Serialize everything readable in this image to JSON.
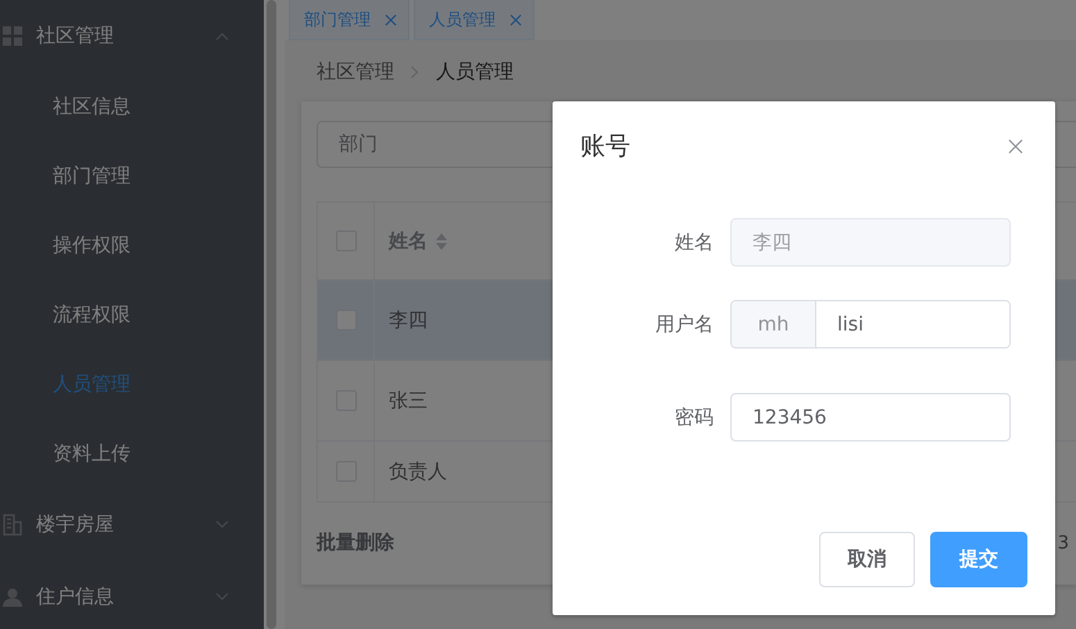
{
  "sidebar": {
    "groups": [
      {
        "label": "社区管理",
        "kind": "grid",
        "expanded": true,
        "children": [
          {
            "label": "社区信息",
            "selected": false
          },
          {
            "label": "部门管理",
            "selected": false
          },
          {
            "label": "操作权限",
            "selected": false
          },
          {
            "label": "流程权限",
            "selected": false
          },
          {
            "label": "人员管理",
            "selected": true
          },
          {
            "label": "资料上传",
            "selected": false
          }
        ]
      },
      {
        "label": "楼宇房屋",
        "kind": "building",
        "expanded": false
      },
      {
        "label": "住户信息",
        "kind": "person",
        "expanded": false
      }
    ]
  },
  "tabs": [
    {
      "label": "部门管理"
    },
    {
      "label": "人员管理"
    }
  ],
  "breadcrumb": [
    "社区管理",
    "人员管理"
  ],
  "filter": {
    "placeholder": "部门"
  },
  "table": {
    "header_checked": false,
    "columns": [
      {
        "label": "姓名",
        "sortable": true
      }
    ],
    "rows": [
      {
        "name": "李四",
        "highlighted": true,
        "checked": false
      },
      {
        "name": "张三",
        "highlighted": false,
        "checked": false
      },
      {
        "name": "负责人",
        "highlighted": false,
        "checked": false
      }
    ]
  },
  "batch_delete": "批量删除",
  "pager_text": "3",
  "dialog": {
    "title": "账号",
    "fields": [
      {
        "label": "姓名",
        "kind": "disabled",
        "value": "李四"
      },
      {
        "label": "用户名",
        "kind": "prefixed",
        "prefix": "mh",
        "value": "lisi"
      },
      {
        "label": "密码",
        "kind": "text",
        "value": "123456"
      }
    ],
    "buttons": [
      {
        "label": "取消",
        "kind": "default"
      },
      {
        "label": "提交",
        "kind": "primary"
      }
    ]
  }
}
